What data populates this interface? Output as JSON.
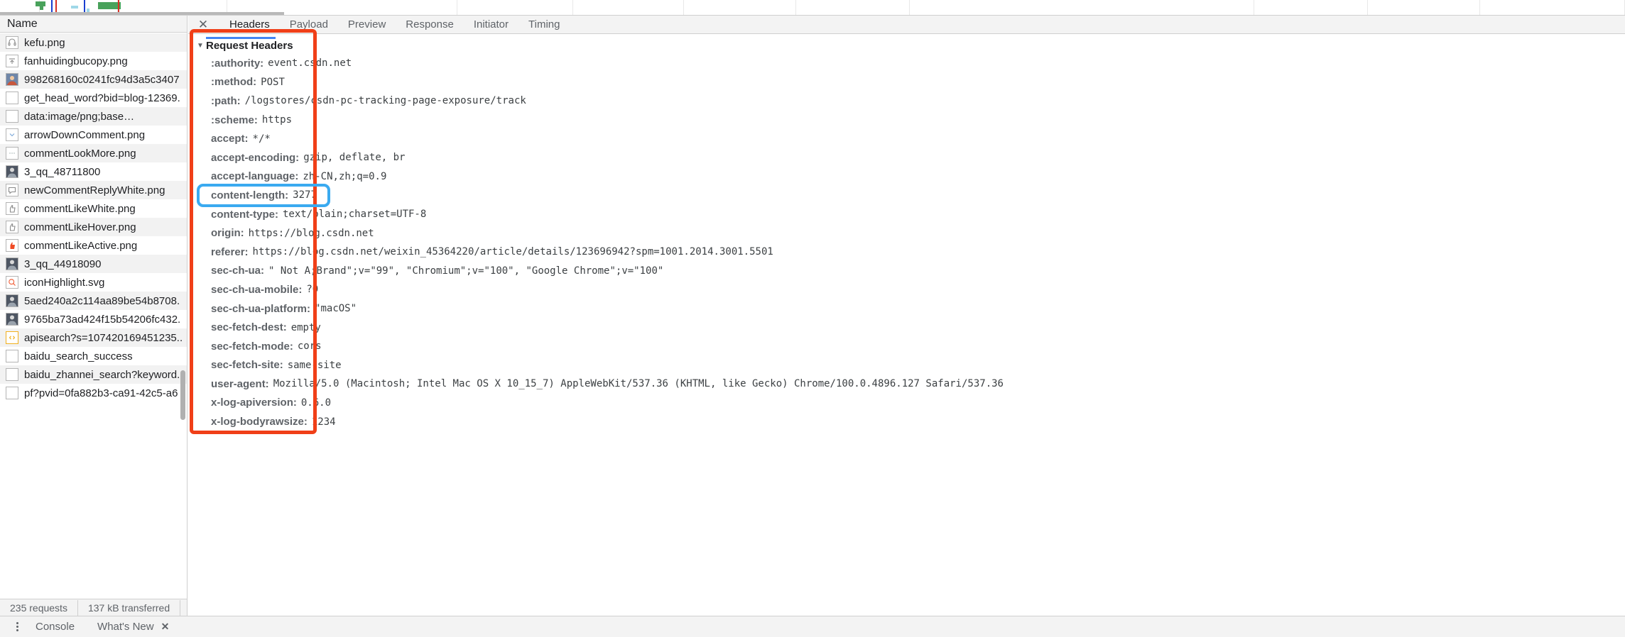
{
  "overview": {
    "label": "network-overview-timeline"
  },
  "request_list": {
    "column_header": "Name",
    "items": [
      {
        "name": "kefu.png",
        "icon": "headset-image-icon"
      },
      {
        "name": "fanhuidingbucopy.png",
        "icon": "arrow-up-image-icon"
      },
      {
        "name": "998268160c0241fc94d3a5c3407",
        "icon": "photo-thumbnail-icon"
      },
      {
        "name": "get_head_word?bid=blog-12369.",
        "icon": "document-icon"
      },
      {
        "name": "data:image/png;base…",
        "icon": "document-icon"
      },
      {
        "name": "arrowDownComment.png",
        "icon": "arrow-down-image-icon"
      },
      {
        "name": "commentLookMore.png",
        "icon": "dots-image-icon"
      },
      {
        "name": "3_qq_48711800",
        "icon": "avatar-thumbnail-icon"
      },
      {
        "name": "newCommentReplyWhite.png",
        "icon": "speech-bubble-image-icon"
      },
      {
        "name": "commentLikeWhite.png",
        "icon": "thumb-up-image-icon"
      },
      {
        "name": "commentLikeHover.png",
        "icon": "thumb-up-image-icon"
      },
      {
        "name": "commentLikeActive.png",
        "icon": "thumb-up-red-image-icon"
      },
      {
        "name": "3_qq_44918090",
        "icon": "avatar-thumbnail-icon"
      },
      {
        "name": "iconHighlight.svg",
        "icon": "magnifier-svg-icon"
      },
      {
        "name": "5aed240a2c114aa89be54b8708.",
        "icon": "avatar-thumbnail-icon"
      },
      {
        "name": "9765ba73ad424f15b54206fc432.",
        "icon": "avatar-thumbnail-icon"
      },
      {
        "name": "apisearch?s=107420169451235..",
        "icon": "script-icon"
      },
      {
        "name": "baidu_search_success",
        "icon": "document-icon"
      },
      {
        "name": "baidu_zhannei_search?keyword..",
        "icon": "document-icon"
      },
      {
        "name": "pf?pvid=0fa882b3-ca91-42c5-a6",
        "icon": "document-icon"
      }
    ],
    "footer": {
      "requests": "235 requests",
      "transferred": "137 kB transferred"
    }
  },
  "details_panel": {
    "close_label": "✕",
    "tabs": [
      {
        "label": "Headers",
        "active": true
      },
      {
        "label": "Payload",
        "active": false
      },
      {
        "label": "Preview",
        "active": false
      },
      {
        "label": "Response",
        "active": false
      },
      {
        "label": "Initiator",
        "active": false
      },
      {
        "label": "Timing",
        "active": false
      }
    ],
    "section": {
      "disclosure": "▼",
      "title": "Request Headers"
    },
    "headers": [
      {
        "name": ":authority:",
        "value": "event.csdn.net"
      },
      {
        "name": ":method:",
        "value": "POST"
      },
      {
        "name": ":path:",
        "value": "/logstores/csdn-pc-tracking-page-exposure/track"
      },
      {
        "name": ":scheme:",
        "value": "https"
      },
      {
        "name": "accept:",
        "value": "*/*"
      },
      {
        "name": "accept-encoding:",
        "value": "gzip, deflate, br"
      },
      {
        "name": "accept-language:",
        "value": "zh-CN,zh;q=0.9"
      },
      {
        "name": "content-length:",
        "value": "3277",
        "highlighted": true
      },
      {
        "name": "content-type:",
        "value": "text/plain;charset=UTF-8"
      },
      {
        "name": "origin:",
        "value": "https://blog.csdn.net"
      },
      {
        "name": "referer:",
        "value": "https://blog.csdn.net/weixin_45364220/article/details/123696942?spm=1001.2014.3001.5501"
      },
      {
        "name": "sec-ch-ua:",
        "value": "\" Not A;Brand\";v=\"99\", \"Chromium\";v=\"100\", \"Google Chrome\";v=\"100\""
      },
      {
        "name": "sec-ch-ua-mobile:",
        "value": "?0"
      },
      {
        "name": "sec-ch-ua-platform:",
        "value": "\"macOS\""
      },
      {
        "name": "sec-fetch-dest:",
        "value": "empty"
      },
      {
        "name": "sec-fetch-mode:",
        "value": "cors"
      },
      {
        "name": "sec-fetch-site:",
        "value": "same-site"
      },
      {
        "name": "user-agent:",
        "value": "Mozilla/5.0 (Macintosh; Intel Mac OS X 10_15_7) AppleWebKit/537.36 (KHTML, like Gecko) Chrome/100.0.4896.127 Safari/537.36"
      },
      {
        "name": "x-log-apiversion:",
        "value": "0.6.0"
      },
      {
        "name": "x-log-bodyrawsize:",
        "value": "1234"
      }
    ]
  },
  "annotations": {
    "red_box_color": "#f03f18",
    "blue_box_color": "#3aaaf0"
  },
  "drawer": {
    "tabs": [
      {
        "label": "Console"
      },
      {
        "label": "What's New"
      }
    ],
    "close_label": "✕"
  }
}
